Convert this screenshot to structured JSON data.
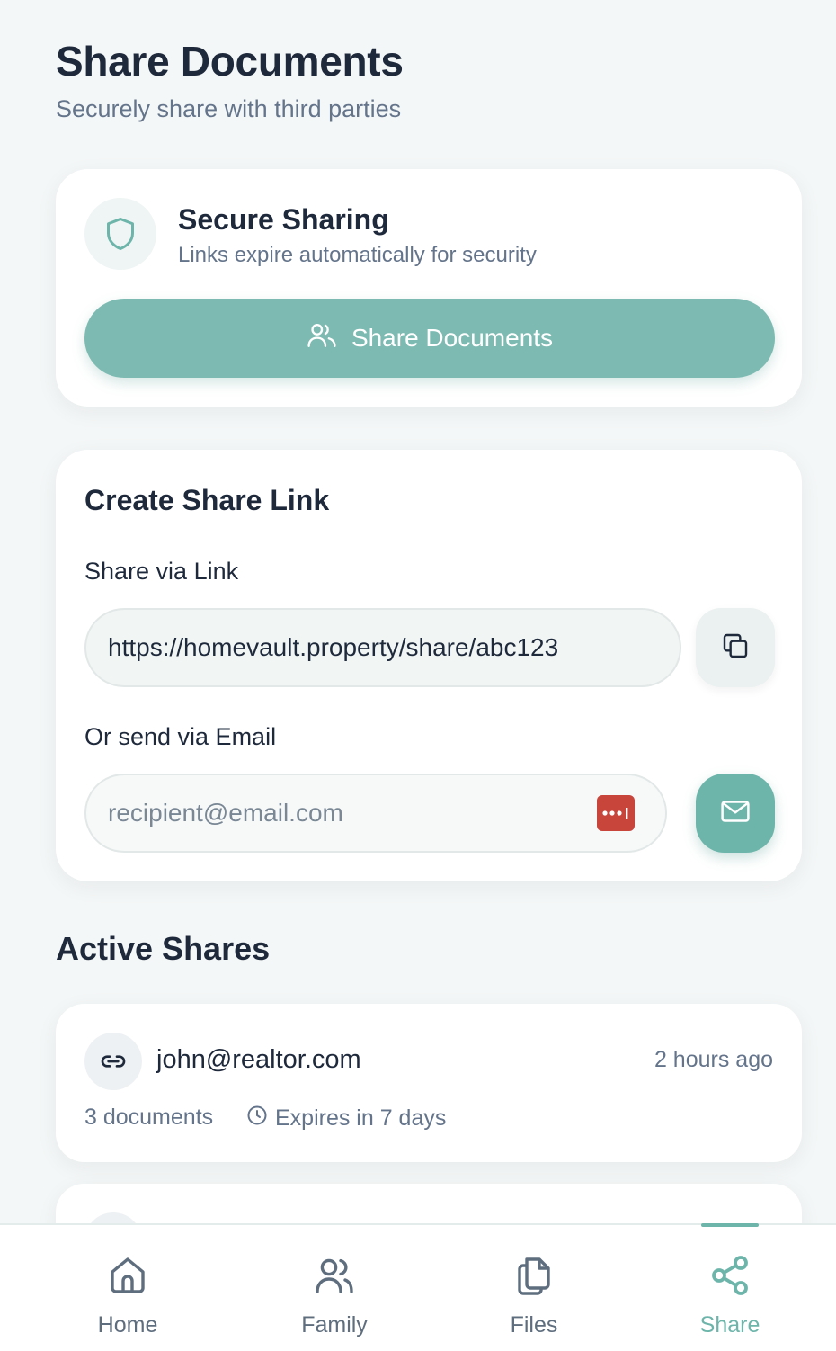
{
  "header": {
    "title": "Share Documents",
    "subtitle": "Securely share with third parties"
  },
  "secure_card": {
    "title": "Secure Sharing",
    "subtitle": "Links expire automatically for security",
    "button_label": "Share Documents",
    "icon": "shield-icon",
    "button_icon": "users-icon"
  },
  "create_link": {
    "title": "Create Share Link",
    "link_label": "Share via Link",
    "link_value": "https://homevault.property/share/abc123",
    "email_label": "Or send via Email",
    "email_placeholder": "recipient@email.com",
    "email_value": ""
  },
  "active_shares": {
    "title": "Active Shares",
    "items": [
      {
        "email": "john@realtor.com",
        "time": "2 hours ago",
        "documents": "3 documents",
        "expiry": "Expires in 7 days"
      }
    ]
  },
  "nav": {
    "items": [
      {
        "label": "Home",
        "icon": "home-icon",
        "active": false
      },
      {
        "label": "Family",
        "icon": "users-icon",
        "active": false
      },
      {
        "label": "Files",
        "icon": "files-icon",
        "active": false
      },
      {
        "label": "Share",
        "icon": "share-icon",
        "active": true
      }
    ]
  },
  "colors": {
    "accent": "#6db5aa",
    "button": "#7dbbb2",
    "text": "#1e293b",
    "muted": "#64748b",
    "password_badge": "#c8453b"
  }
}
